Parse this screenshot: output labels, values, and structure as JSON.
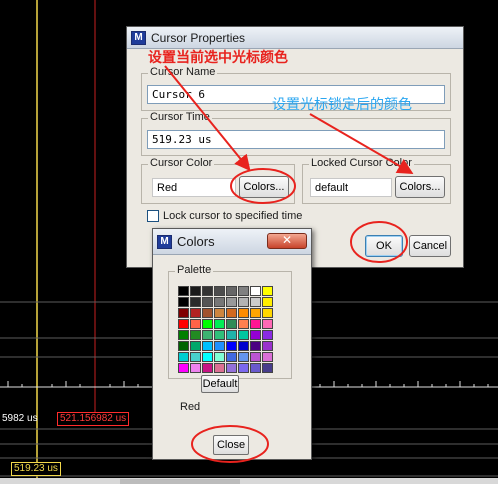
{
  "cursor_props": {
    "title": "Cursor Properties",
    "name_group": "Cursor Name",
    "name_value": "Cursor 6",
    "time_group": "Cursor Time",
    "time_value": "519.23 us",
    "color_group": "Cursor Color",
    "color_value": "Red",
    "colors_btn": "Colors...",
    "locked_group": "Locked Cursor Color",
    "locked_value": "default",
    "locked_colors_btn": "Colors...",
    "lock_checkbox_label": "Lock cursor to specified time",
    "ok_btn": "OK",
    "cancel_btn": "Cancel"
  },
  "colors_dialog": {
    "title": "Colors",
    "palette_group": "Palette",
    "default_btn": "Default",
    "current_label": "Red",
    "close_btn": "Close",
    "swatches": [
      "#000000",
      "#1a1a1a",
      "#333333",
      "#4d4d4d",
      "#666666",
      "#808080",
      "#ffffff",
      "#ffff00",
      "#000000",
      "#2b2b2b",
      "#555555",
      "#777777",
      "#999999",
      "#b3b3b3",
      "#cccccc",
      "#ffee00",
      "#800000",
      "#b22222",
      "#a0522d",
      "#cd853f",
      "#d2691e",
      "#ff8c00",
      "#ffa500",
      "#ffd700",
      "#ff0000",
      "#ff6347",
      "#00ff00",
      "#00ee55",
      "#2e8b57",
      "#ff7f50",
      "#ff1493",
      "#ff69b4",
      "#008000",
      "#228b22",
      "#3cb371",
      "#2fbf7a",
      "#20b2aa",
      "#00c8a0",
      "#9400d3",
      "#8a2be2",
      "#006400",
      "#00a86b",
      "#00bfff",
      "#1e90ff",
      "#0000ff",
      "#0000cd",
      "#4b0082",
      "#9932cc",
      "#00ced1",
      "#48d1cc",
      "#00ffff",
      "#7fffd4",
      "#4169e1",
      "#6495ed",
      "#ba55d3",
      "#da70d6",
      "#ff00ff",
      "#ee82ee",
      "#c71585",
      "#db7093",
      "#9370db",
      "#7b68ee",
      "#6a5acd",
      "#483d8b"
    ]
  },
  "waveform": {
    "time_white": "5982 us",
    "time_red": "521.156982 us",
    "time_yellow": "519.23 us"
  },
  "annotations": {
    "set_current": "设置当前选中光标颜色",
    "set_locked": "设置光标锁定后的颜色"
  },
  "colors": {
    "annotation_red": "#e8231e",
    "annotation_blue": "#2aa6f0",
    "cursor_yellow": "#f2d84b",
    "cursor_red": "#c62020"
  }
}
